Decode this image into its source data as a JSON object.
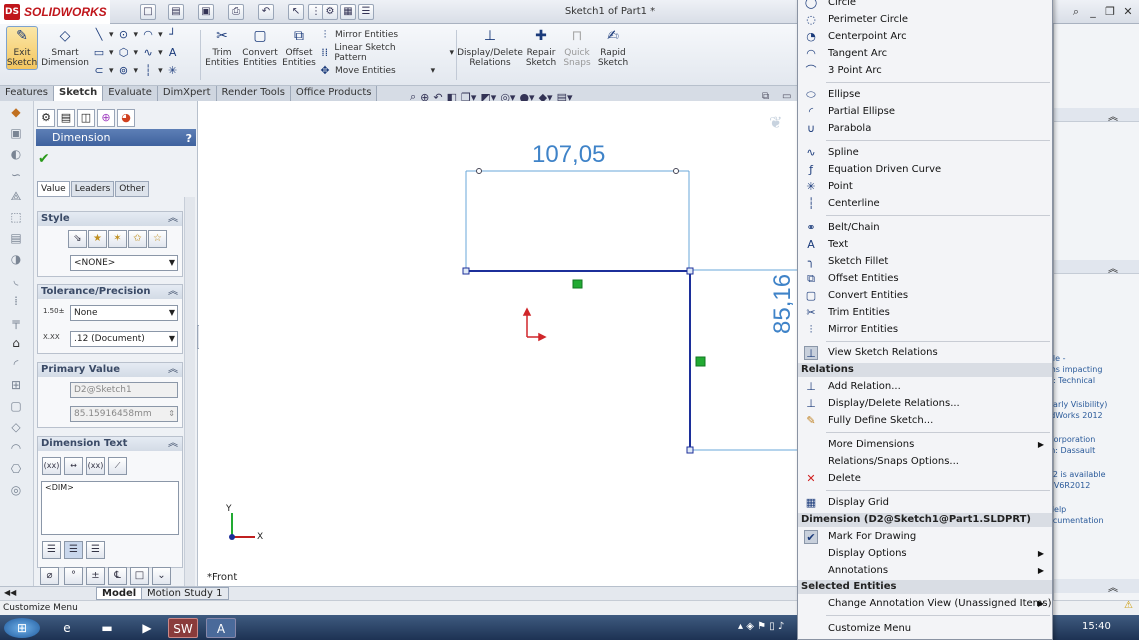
{
  "app": {
    "logo_text": "SOLIDWORKS",
    "document_title": "Sketch1 of Part1 *"
  },
  "command_manager": {
    "exit_sketch": "Exit Sketch",
    "smart_dimension": "Smart Dimension",
    "trim_entities": "Trim Entities",
    "convert_entities": "Convert Entities",
    "offset_entities": "Offset Entities",
    "mirror_entities": "Mirror Entities",
    "linear_sketch_pattern": "Linear Sketch Pattern",
    "move_entities": "Move Entities",
    "display_delete_relations": "Display/Delete Relations",
    "repair_sketch": "Repair Sketch",
    "quick_snaps": "Quick Snaps",
    "rapid_sketch": "Rapid Sketch"
  },
  "tabs": [
    "Features",
    "Sketch",
    "Evaluate",
    "DimXpert",
    "Render Tools",
    "Office Products"
  ],
  "active_tab": "Sketch",
  "property_manager": {
    "title": "Dimension",
    "help": "?",
    "subtabs": [
      "Value",
      "Leaders",
      "Other"
    ],
    "style": {
      "header": "Style",
      "selected": "<NONE>"
    },
    "tolerance": {
      "header": "Tolerance/Precision",
      "tolerance_type": "None",
      "precision": ".12 (Document)"
    },
    "primary_value": {
      "header": "Primary Value",
      "name": "D2@Sketch1",
      "value": "85.15916458mm"
    },
    "dimension_text": {
      "header": "Dimension Text",
      "text": "<DIM>"
    }
  },
  "canvas": {
    "dim_horizontal": "107,05",
    "dim_vertical": "85,16",
    "view_label": "*Front",
    "axis_x": "X",
    "axis_y": "Y"
  },
  "bottom_tabs": [
    "Model",
    "Motion Study 1"
  ],
  "status": "Customize Menu",
  "taskbar": {
    "clock": "15:40"
  },
  "context_menu": {
    "items_a": [
      "Circle",
      "Perimeter Circle",
      "Centerpoint Arc",
      "Tangent Arc",
      "3 Point Arc"
    ],
    "items_b": [
      "Ellipse",
      "Partial Ellipse",
      "Parabola"
    ],
    "items_c": [
      "Spline",
      "Equation Driven Curve",
      "Point",
      "Centerline"
    ],
    "items_d": [
      "Belt/Chain",
      "Text",
      "Sketch Fillet",
      "Offset Entities",
      "Convert Entities",
      "Trim Entities",
      "Mirror Entities"
    ],
    "view_relations": "View Sketch Relations",
    "relations_header": "Relations",
    "relations_items": [
      "Add Relation...",
      "Display/Delete Relations...",
      "Fully Define Sketch..."
    ],
    "misc_items": [
      "More Dimensions",
      "Relations/Snaps Options...",
      "Delete"
    ],
    "display_grid": "Display Grid",
    "dimension_header": "Dimension (D2@Sketch1@Part1.SLDPRT)",
    "dimension_items": [
      "Mark For Drawing",
      "Display Options",
      "Annotations"
    ],
    "selected_header": "Selected Entities",
    "change_annotation_view": "Change Annotation View (Unassigned Items)",
    "customize_menu": "Customize Menu"
  },
  "task_pane": {
    "lines": [
      "ole -",
      "ms impacting",
      "n: Technical",
      "Early Visibility)",
      "idWorks 2012",
      "Corporation",
      "in: Dassault",
      "P2 is available",
      "r V6R2012",
      "Help",
      "ocumentation"
    ]
  }
}
